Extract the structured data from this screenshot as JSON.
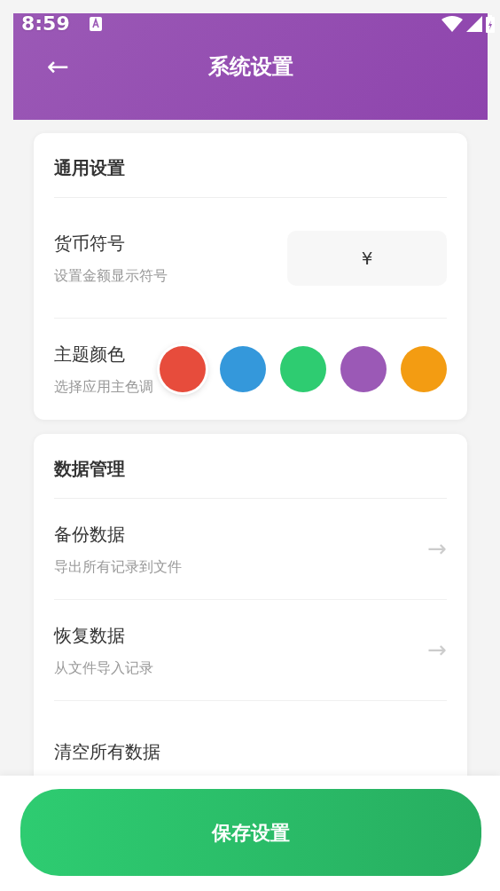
{
  "status_bar": {
    "time": "8:59"
  },
  "header": {
    "back": "←",
    "title": "系统设置"
  },
  "sections": [
    {
      "title": "通用设置",
      "rows": [
        {
          "kind": "input",
          "label": "货币符号",
          "hint": "设置金额显示符号",
          "value": "¥"
        },
        {
          "kind": "colors",
          "label": "主题颜色",
          "hint": "选择应用主色调",
          "swatches": [
            {
              "color": "#e74c3c",
              "selected": true
            },
            {
              "color": "#3498db",
              "selected": false
            },
            {
              "color": "#2ecc71",
              "selected": false
            },
            {
              "color": "#9b59b6",
              "selected": false
            },
            {
              "color": "#f39c12",
              "selected": false
            }
          ]
        }
      ]
    },
    {
      "title": "数据管理",
      "rows": [
        {
          "kind": "link",
          "label": "备份数据",
          "hint": "导出所有记录到文件",
          "arrow": "→"
        },
        {
          "kind": "link",
          "label": "恢复数据",
          "hint": "从文件导入记录",
          "arrow": "→"
        },
        {
          "kind": "link",
          "label": "清空所有数据"
        }
      ]
    }
  ],
  "save_button": "保存设置"
}
